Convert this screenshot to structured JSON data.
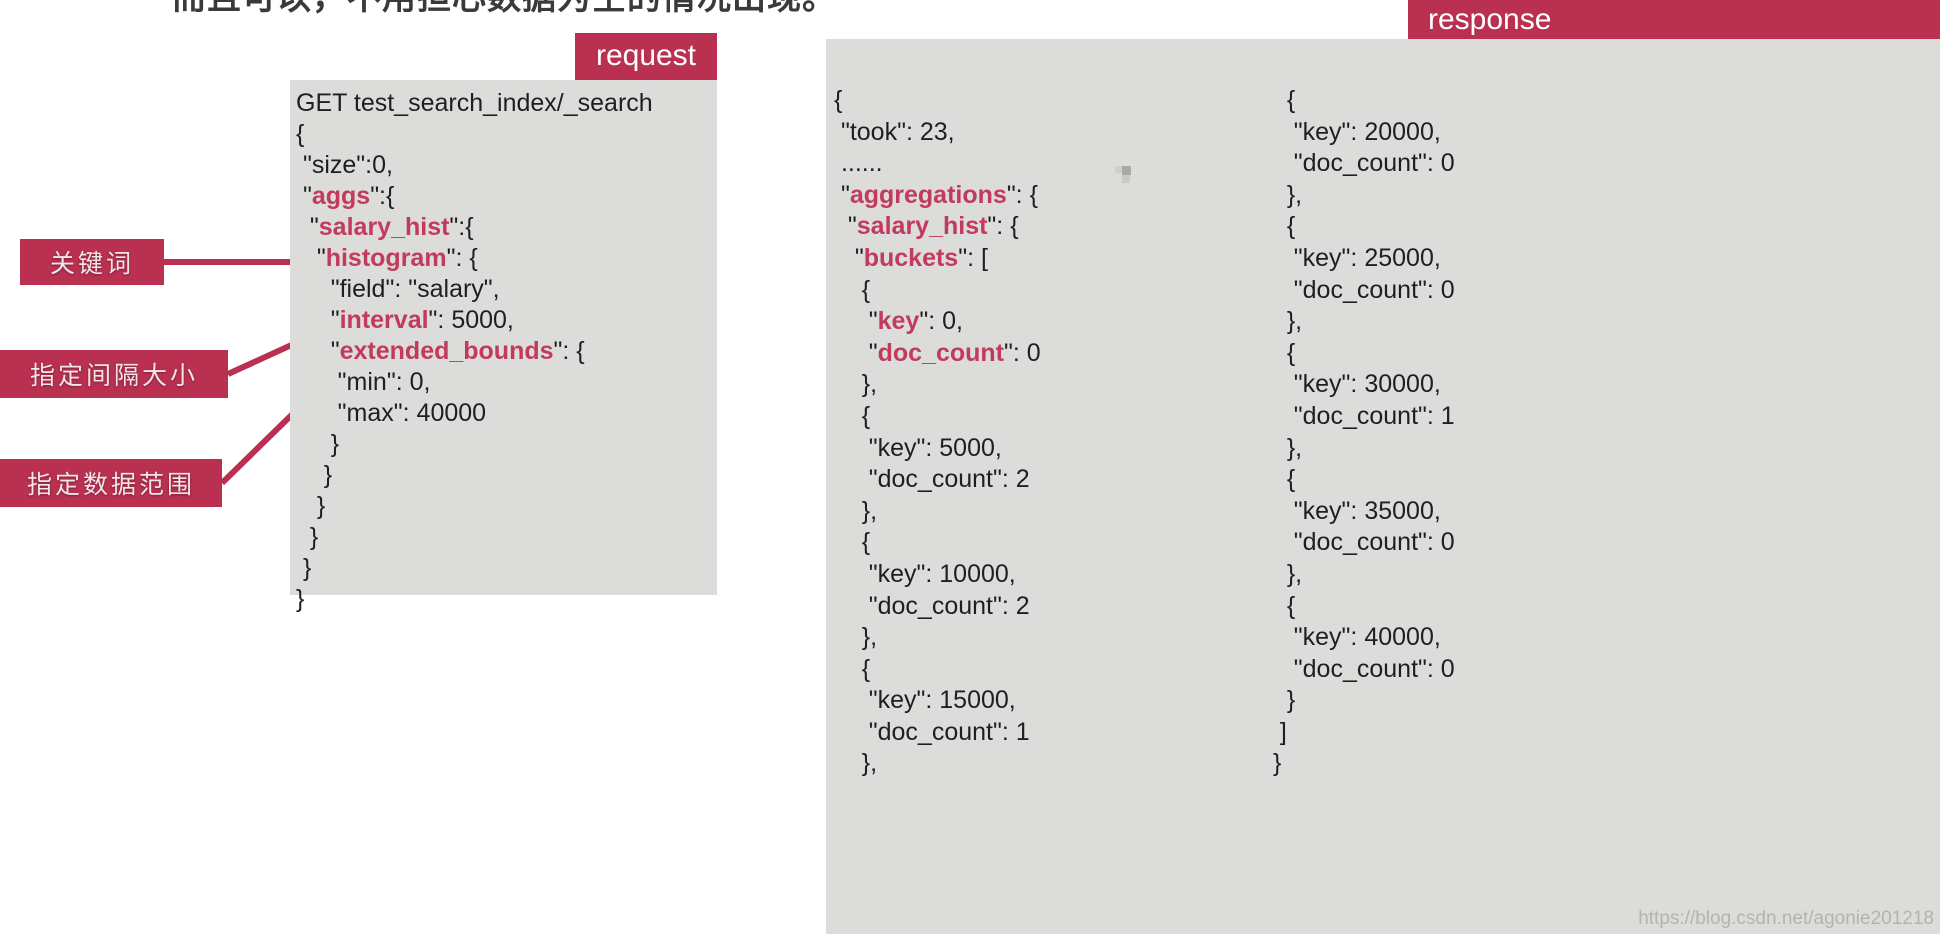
{
  "page": {
    "top_cut_heading": "而且可以，不用担心数据为空的情况出现。"
  },
  "labels": {
    "request_tag": "request",
    "response_tag": "response"
  },
  "annotations": [
    {
      "text": "关键词",
      "name": "keyword"
    },
    {
      "text": "指定间隔大小",
      "name": "interval-size"
    },
    {
      "text": "指定数据范围",
      "name": "data-range"
    }
  ],
  "request_code": [
    [
      {
        "t": "GET test_search_index/_search",
        "c": "plain"
      }
    ],
    [
      {
        "t": "{",
        "c": "plain"
      }
    ],
    [
      {
        "t": " \"",
        "c": "plain"
      },
      {
        "t": "size",
        "c": "plain"
      },
      {
        "t": "\":0,",
        "c": "plain"
      }
    ],
    [
      {
        "t": " \"",
        "c": "plain"
      },
      {
        "t": "aggs",
        "c": "k"
      },
      {
        "t": "\":{",
        "c": "plain"
      }
    ],
    [
      {
        "t": "  \"",
        "c": "plain"
      },
      {
        "t": "salary_hist",
        "c": "k"
      },
      {
        "t": "\":{",
        "c": "plain"
      }
    ],
    [
      {
        "t": "   \"",
        "c": "plain"
      },
      {
        "t": "histogram",
        "c": "k"
      },
      {
        "t": "\": {",
        "c": "plain"
      }
    ],
    [
      {
        "t": "     \"field\": \"salary\",",
        "c": "plain"
      }
    ],
    [
      {
        "t": "     \"",
        "c": "plain"
      },
      {
        "t": "interval",
        "c": "k"
      },
      {
        "t": "\": 5000,",
        "c": "plain"
      }
    ],
    [
      {
        "t": "     \"",
        "c": "plain"
      },
      {
        "t": "extended_bounds",
        "c": "k"
      },
      {
        "t": "\": {",
        "c": "plain"
      }
    ],
    [
      {
        "t": "      \"min\": 0,",
        "c": "plain"
      }
    ],
    [
      {
        "t": "      \"max\": 40000",
        "c": "plain"
      }
    ],
    [
      {
        "t": "     }",
        "c": "plain"
      }
    ],
    [
      {
        "t": "    }",
        "c": "plain"
      }
    ],
    [
      {
        "t": "   }",
        "c": "plain"
      }
    ],
    [
      {
        "t": "  }",
        "c": "plain"
      }
    ],
    [
      {
        "t": " }",
        "c": "plain"
      }
    ],
    [
      {
        "t": "}",
        "c": "plain"
      }
    ]
  ],
  "response_code_left": [
    [
      {
        "t": "{",
        "c": "plain"
      }
    ],
    [
      {
        "t": " \"took\": 23,",
        "c": "plain"
      }
    ],
    [
      {
        "t": " ......",
        "c": "plain"
      }
    ],
    [
      {
        "t": " \"",
        "c": "plain"
      },
      {
        "t": "aggregations",
        "c": "k"
      },
      {
        "t": "\": {",
        "c": "plain"
      }
    ],
    [
      {
        "t": "  \"",
        "c": "plain"
      },
      {
        "t": "salary_hist",
        "c": "k"
      },
      {
        "t": "\": {",
        "c": "plain"
      }
    ],
    [
      {
        "t": "   \"",
        "c": "plain"
      },
      {
        "t": "buckets",
        "c": "k"
      },
      {
        "t": "\": [",
        "c": "plain"
      }
    ],
    [
      {
        "t": "    {",
        "c": "plain"
      }
    ],
    [
      {
        "t": "     \"",
        "c": "plain"
      },
      {
        "t": "key",
        "c": "k"
      },
      {
        "t": "\": 0,",
        "c": "plain"
      }
    ],
    [
      {
        "t": "     \"",
        "c": "plain"
      },
      {
        "t": "doc_count",
        "c": "k"
      },
      {
        "t": "\": 0",
        "c": "plain"
      }
    ],
    [
      {
        "t": "    },",
        "c": "plain"
      }
    ],
    [
      {
        "t": "    {",
        "c": "plain"
      }
    ],
    [
      {
        "t": "     \"key\": 5000,",
        "c": "plain"
      }
    ],
    [
      {
        "t": "     \"doc_count\": 2",
        "c": "plain"
      }
    ],
    [
      {
        "t": "    },",
        "c": "plain"
      }
    ],
    [
      {
        "t": "    {",
        "c": "plain"
      }
    ],
    [
      {
        "t": "     \"key\": 10000,",
        "c": "plain"
      }
    ],
    [
      {
        "t": "     \"doc_count\": 2",
        "c": "plain"
      }
    ],
    [
      {
        "t": "    },",
        "c": "plain"
      }
    ],
    [
      {
        "t": "    {",
        "c": "plain"
      }
    ],
    [
      {
        "t": "     \"key\": 15000,",
        "c": "plain"
      }
    ],
    [
      {
        "t": "     \"doc_count\": 1",
        "c": "plain"
      }
    ],
    [
      {
        "t": "    },",
        "c": "plain"
      }
    ]
  ],
  "response_code_right": [
    [
      {
        "t": "   {",
        "c": "plain"
      }
    ],
    [
      {
        "t": "    \"key\": 20000,",
        "c": "plain"
      }
    ],
    [
      {
        "t": "    \"doc_count\": 0",
        "c": "plain"
      }
    ],
    [
      {
        "t": "   },",
        "c": "plain"
      }
    ],
    [
      {
        "t": "   {",
        "c": "plain"
      }
    ],
    [
      {
        "t": "    \"key\": 25000,",
        "c": "plain"
      }
    ],
    [
      {
        "t": "    \"doc_count\": 0",
        "c": "plain"
      }
    ],
    [
      {
        "t": "   },",
        "c": "plain"
      }
    ],
    [
      {
        "t": "   {",
        "c": "plain"
      }
    ],
    [
      {
        "t": "    \"key\": 30000,",
        "c": "plain"
      }
    ],
    [
      {
        "t": "    \"doc_count\": 1",
        "c": "plain"
      }
    ],
    [
      {
        "t": "   },",
        "c": "plain"
      }
    ],
    [
      {
        "t": "   {",
        "c": "plain"
      }
    ],
    [
      {
        "t": "    \"key\": 35000,",
        "c": "plain"
      }
    ],
    [
      {
        "t": "    \"doc_count\": 0",
        "c": "plain"
      }
    ],
    [
      {
        "t": "   },",
        "c": "plain"
      }
    ],
    [
      {
        "t": "   {",
        "c": "plain"
      }
    ],
    [
      {
        "t": "    \"key\": 40000,",
        "c": "plain"
      }
    ],
    [
      {
        "t": "    \"doc_count\": 0",
        "c": "plain"
      }
    ],
    [
      {
        "t": "   }",
        "c": "plain"
      }
    ],
    [
      {
        "t": "  ]",
        "c": "plain"
      }
    ],
    [
      {
        "t": " }",
        "c": "plain"
      }
    ]
  ],
  "watermark": "https://blog.csdn.net/agonie201218",
  "colors": {
    "accent": "#b93050",
    "keyword": "#c23a5c",
    "panel_bg": "#dcdcda",
    "text": "#1f1f1f"
  }
}
